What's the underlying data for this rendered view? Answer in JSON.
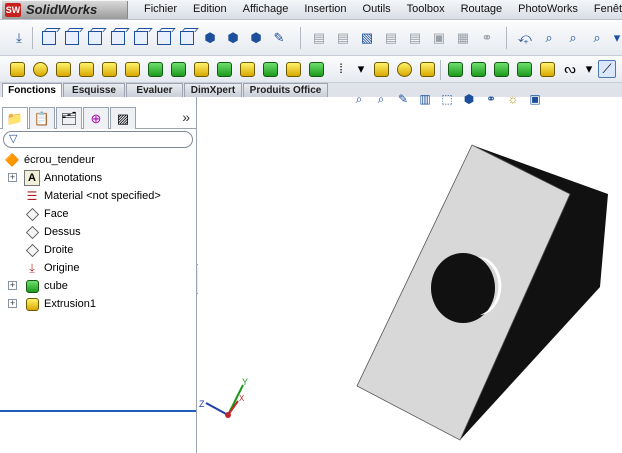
{
  "app": {
    "logo_mark": "SW",
    "logo_text": "SolidWorks"
  },
  "menu": [
    {
      "label": "Fichier"
    },
    {
      "label": "Edition"
    },
    {
      "label": "Affichage"
    },
    {
      "label": "Insertion"
    },
    {
      "label": "Outils"
    },
    {
      "label": "Toolbox"
    },
    {
      "label": "Routage"
    },
    {
      "label": "PhotoWorks"
    },
    {
      "label": "Fenêtre"
    }
  ],
  "command_tabs": [
    {
      "label": "Fonctions",
      "active": true
    },
    {
      "label": "Esquisse"
    },
    {
      "label": "Evaluer"
    },
    {
      "label": "DimXpert"
    },
    {
      "label": "Produits Office"
    }
  ],
  "panel": {
    "chevron": "»",
    "filter_icon": "filter-icon"
  },
  "tree": {
    "root": "écrou_tendeur",
    "items": [
      {
        "label": "Annotations",
        "icon": "annotations-icon",
        "expandable": true
      },
      {
        "label": "Material <not specified>",
        "icon": "material-icon",
        "expandable": false
      },
      {
        "label": "Face",
        "icon": "plane-icon",
        "expandable": false
      },
      {
        "label": "Dessus",
        "icon": "plane-icon",
        "expandable": false
      },
      {
        "label": "Droite",
        "icon": "plane-icon",
        "expandable": false
      },
      {
        "label": "Origine",
        "icon": "origin-icon",
        "expandable": false
      },
      {
        "label": "cube",
        "icon": "feature-icon",
        "expandable": true
      },
      {
        "label": "Extrusion1",
        "icon": "feature-icon",
        "expandable": true
      }
    ]
  },
  "triad": {
    "x": "X",
    "y": "Y",
    "z": "Z"
  },
  "colors": {
    "accent": "#1d5fb8",
    "part_face": "#d8d8d8",
    "part_side": "#111111",
    "logo_red": "#c8211d"
  }
}
